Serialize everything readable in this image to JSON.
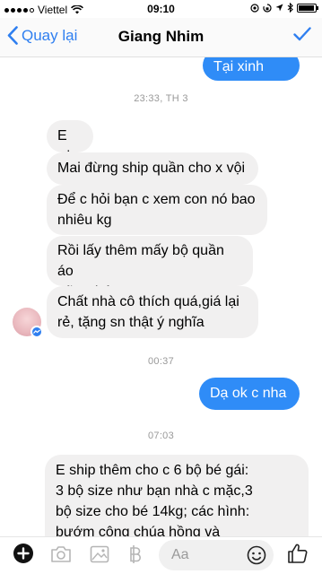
{
  "status_bar": {
    "carrier": "Viettel",
    "time": "09:10",
    "battery_level": 0.92
  },
  "nav": {
    "back_label": "Quay lại",
    "title": "Giang Nhim"
  },
  "messages": [
    {
      "dir": "out",
      "lines": [
        "Tại xinh quá"
      ]
    },
    {
      "type": "timestamp",
      "text": "23:33, TH 3"
    },
    {
      "dir": "in",
      "lines": [
        "E ơi"
      ]
    },
    {
      "dir": "in",
      "lines": [
        "Mai đừng ship quần cho x vội"
      ]
    },
    {
      "dir": "in",
      "lines": [
        "Để c hỏi bạn c xem con nó bao",
        "nhiêu kg"
      ]
    },
    {
      "dir": "in",
      "lines": [
        "Rồi lấy thêm mấy bộ quần áo",
        "nữa nhé"
      ]
    },
    {
      "dir": "in",
      "lines": [
        "Chất nhà cô thích quá,giá lại",
        "rẻ, tặng sn thật ý nghĩa"
      ]
    },
    {
      "type": "timestamp",
      "text": "00:37"
    },
    {
      "dir": "out",
      "lines": [
        "Dạ ok c nha"
      ]
    },
    {
      "type": "timestamp",
      "text": "07:03"
    },
    {
      "dir": "out",
      "lines": [
        "E ship thêm cho c 6 bộ bé gái:",
        "3 bộ size như bạn nhà c mặc,3",
        "bộ size cho bé 14kg; các hình:",
        "bướm công chúa hồng và"
      ]
    }
  ],
  "composer": {
    "placeholder": "Aa"
  },
  "colors": {
    "accent": "#2f7ff0",
    "outgoing": "#2f8cf7",
    "incoming": "#f1f0f0"
  }
}
